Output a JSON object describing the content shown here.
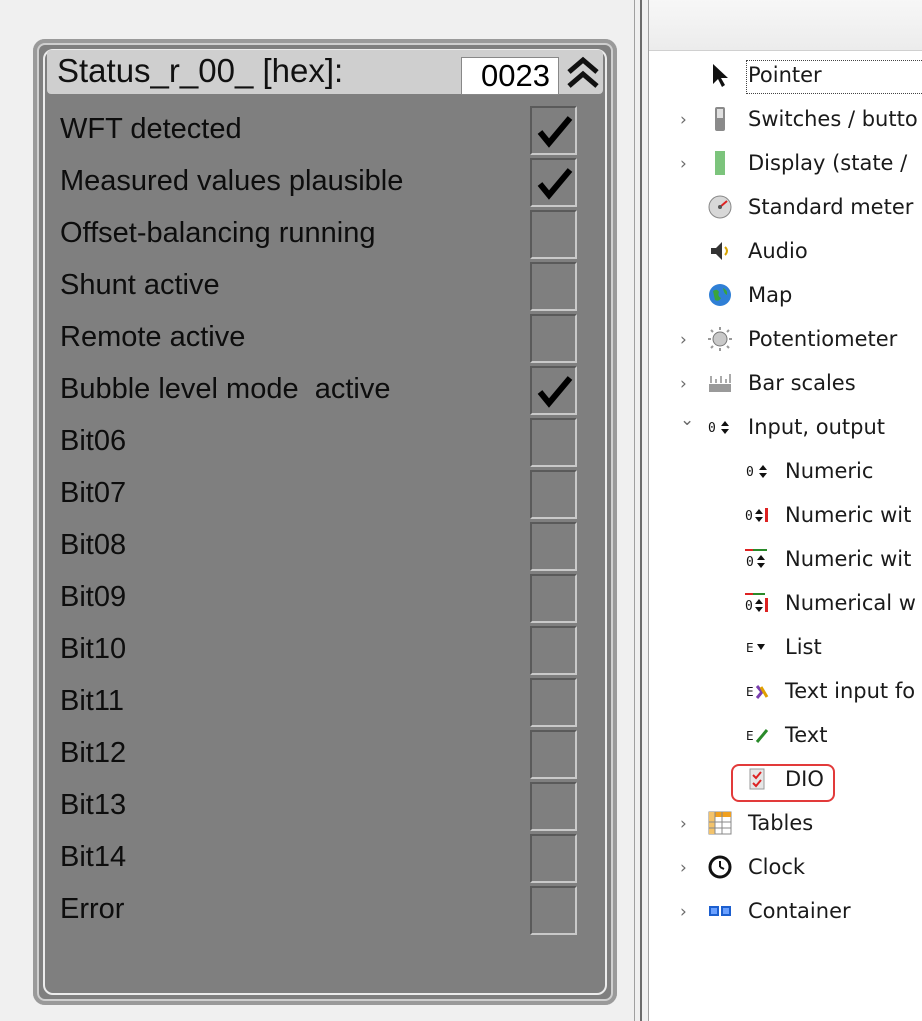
{
  "dio_widget": {
    "title": "Status_r_00_ [hex]:",
    "hex_value": "0023",
    "bits": [
      {
        "label": "WFT detected",
        "checked": true
      },
      {
        "label": "Measured values plausible",
        "checked": true
      },
      {
        "label": "Offset-balancing running",
        "checked": false
      },
      {
        "label": "Shunt active",
        "checked": false
      },
      {
        "label": "Remote active",
        "checked": false
      },
      {
        "label": "Bubble level mode  active",
        "checked": true
      },
      {
        "label": "Bit06",
        "checked": false
      },
      {
        "label": "Bit07",
        "checked": false
      },
      {
        "label": "Bit08",
        "checked": false
      },
      {
        "label": "Bit09",
        "checked": false
      },
      {
        "label": "Bit10",
        "checked": false
      },
      {
        "label": "Bit11",
        "checked": false
      },
      {
        "label": "Bit12",
        "checked": false
      },
      {
        "label": "Bit13",
        "checked": false
      },
      {
        "label": "Bit14",
        "checked": false
      },
      {
        "label": "Error",
        "checked": false
      }
    ]
  },
  "tree": {
    "items": [
      {
        "label": "Pointer",
        "icon": "pointer-arrow-icon",
        "chevron": ""
      },
      {
        "label": "Switches / butto",
        "icon": "switch-icon",
        "chevron": "›"
      },
      {
        "label": "Display (state /",
        "icon": "display-bar-icon",
        "chevron": "›"
      },
      {
        "label": "Standard meter",
        "icon": "meter-gauge-icon",
        "chevron": ""
      },
      {
        "label": "Audio",
        "icon": "speaker-icon",
        "chevron": ""
      },
      {
        "label": "Map",
        "icon": "globe-icon",
        "chevron": ""
      },
      {
        "label": "Potentiometer",
        "icon": "potentiometer-icon",
        "chevron": "›"
      },
      {
        "label": "Bar scales",
        "icon": "bar-scale-icon",
        "chevron": "›"
      },
      {
        "label": "Input, output",
        "icon": "numeric-io-icon",
        "chevron": "⌄"
      },
      {
        "label": "Numeric",
        "icon": "numeric-spin-icon",
        "chevron": ""
      },
      {
        "label": "Numeric wit",
        "icon": "numeric-spin-bar-icon",
        "chevron": ""
      },
      {
        "label": "Numeric wit",
        "icon": "numeric-spin-limit-icon",
        "chevron": ""
      },
      {
        "label": "Numerical w",
        "icon": "numeric-spin-limit-bar-icon",
        "chevron": ""
      },
      {
        "label": "List",
        "icon": "list-dropdown-icon",
        "chevron": ""
      },
      {
        "label": "Text input fo",
        "icon": "text-input-icon",
        "chevron": ""
      },
      {
        "label": "Text",
        "icon": "text-edit-icon",
        "chevron": ""
      },
      {
        "label": "DIO",
        "icon": "dio-checkbox-icon",
        "chevron": ""
      },
      {
        "label": "Tables",
        "icon": "table-grid-icon",
        "chevron": "›"
      },
      {
        "label": "Clock",
        "icon": "clock-icon",
        "chevron": "›"
      },
      {
        "label": "Container",
        "icon": "container-icon",
        "chevron": "›"
      }
    ]
  },
  "colors": {
    "widget_background": "#7f7f7f",
    "header_background": "#cfcfcf",
    "highlight_border": "#e23a3a"
  }
}
